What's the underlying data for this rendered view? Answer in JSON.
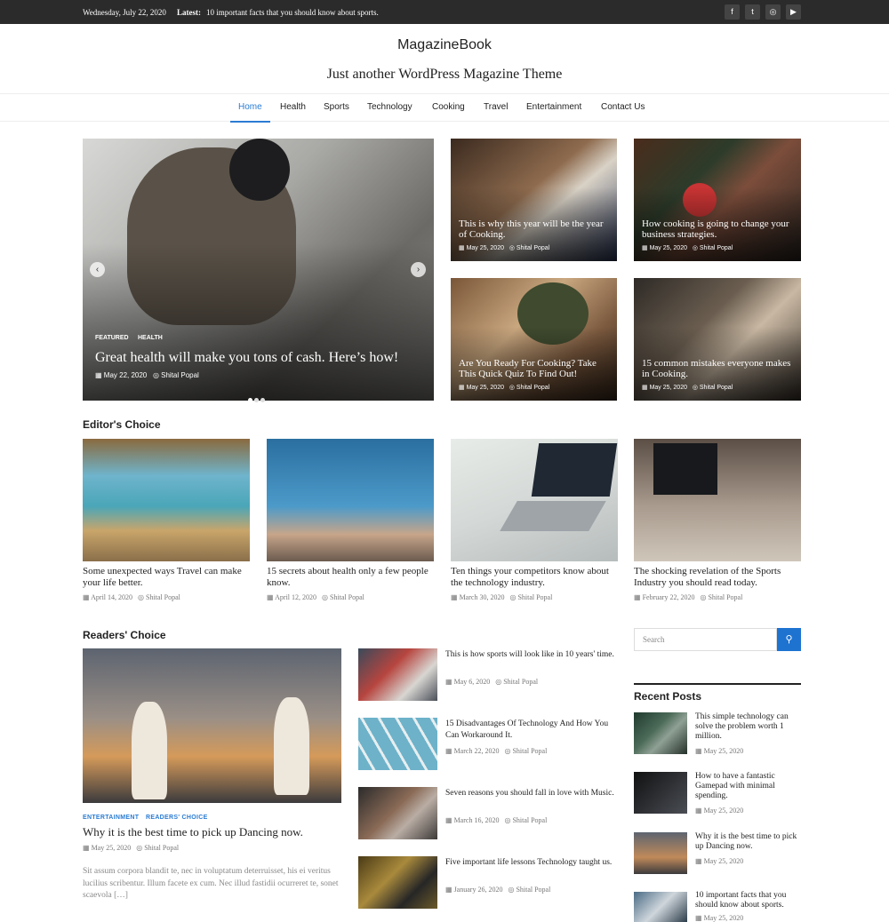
{
  "topbar": {
    "date": "Wednesday, July 22, 2020",
    "latest_label": "Latest:",
    "latest_text": "10 important facts that you should know about sports.",
    "social": [
      {
        "icon": "facebook-icon",
        "glyph": "f"
      },
      {
        "icon": "twitter-icon",
        "glyph": "t"
      },
      {
        "icon": "instagram-icon",
        "glyph": "◎"
      },
      {
        "icon": "youtube-icon",
        "glyph": "▶"
      }
    ]
  },
  "site": {
    "title": "MagazineBook",
    "tagline": "Just another WordPress Magazine Theme"
  },
  "nav": [
    "Home",
    "Health",
    "Sports",
    "Technology",
    "Cooking",
    "Travel",
    "Entertainment",
    "Contact Us"
  ],
  "slider": {
    "categories": [
      "FEATURED",
      "HEALTH"
    ],
    "title": "Great health will make you tons of cash. Here’s how!",
    "date": "May 22, 2020",
    "author": "Shital Popal",
    "prev": "‹",
    "next": "›"
  },
  "grid": [
    {
      "title": "This is why this year will be the year of Cooking.",
      "date": "May 25, 2020",
      "author": "Shital Popal"
    },
    {
      "title": "How cooking is going to change your business strategies.",
      "date": "May 25, 2020",
      "author": "Shital Popal"
    },
    {
      "title": "Are You Ready For Cooking? Take This Quick Quiz To Find Out!",
      "date": "May 25, 2020",
      "author": "Shital Popal"
    },
    {
      "title": "15 common mistakes everyone makes in Cooking.",
      "date": "May 25, 2020",
      "author": "Shital Popal"
    }
  ],
  "editors_choice": {
    "heading": "Editor's Choice",
    "posts": [
      {
        "title": "Some unexpected ways Travel can make your life better.",
        "date": "April 14, 2020",
        "author": "Shital Popal"
      },
      {
        "title": "15 secrets about health only a few people know.",
        "date": "April 12, 2020",
        "author": "Shital Popal"
      },
      {
        "title": "Ten things your competitors know about the technology industry.",
        "date": "March 30, 2020",
        "author": "Shital Popal"
      },
      {
        "title": "The shocking revelation of the Sports Industry you should read today.",
        "date": "February 22, 2020",
        "author": "Shital Popal"
      }
    ]
  },
  "readers_choice": {
    "heading": "Readers' Choice",
    "main": {
      "categories": [
        "ENTERTAINMENT",
        "READERS' CHOICE"
      ],
      "title": "Why it is the best time to pick up Dancing now.",
      "date": "May 25, 2020",
      "author": "Shital Popal",
      "excerpt": "Sit assum corpora blandit te, nec in voluptatum deterruisset, his ei veritus lucilius scribentur. Illum facete ex cum. Nec illud fastidii ocurreret te, sonet scaevola […]"
    },
    "list": [
      {
        "title": "This is how sports will look like in 10 years' time.",
        "date": "May 6, 2020",
        "author": "Shital Popal"
      },
      {
        "title": "15 Disadvantages Of Technology And How You Can Workaround It.",
        "date": "March 22, 2020",
        "author": "Shital Popal"
      },
      {
        "title": "Seven reasons you should fall in love with Music.",
        "date": "March 16, 2020",
        "author": "Shital Popal"
      },
      {
        "title": "Five important life lessons Technology taught us.",
        "date": "January 26, 2020",
        "author": "Shital Popal"
      }
    ]
  },
  "sidebar": {
    "search_placeholder": "Search",
    "recent_heading": "Recent Posts",
    "recent": [
      {
        "title": "This simple technology can solve the problem worth 1 million.",
        "date": "May 25, 2020"
      },
      {
        "title": "How to have a fantastic Gamepad with minimal spending.",
        "date": "May 25, 2020"
      },
      {
        "title": "Why it is the best time to pick up Dancing now.",
        "date": "May 25, 2020"
      },
      {
        "title": "10 important facts that you should know about sports.",
        "date": "May 25, 2020"
      }
    ]
  },
  "colors": {
    "accent": "#2b7cd3",
    "topbar": "#2b2b2b",
    "search_button": "#1e73d1"
  }
}
